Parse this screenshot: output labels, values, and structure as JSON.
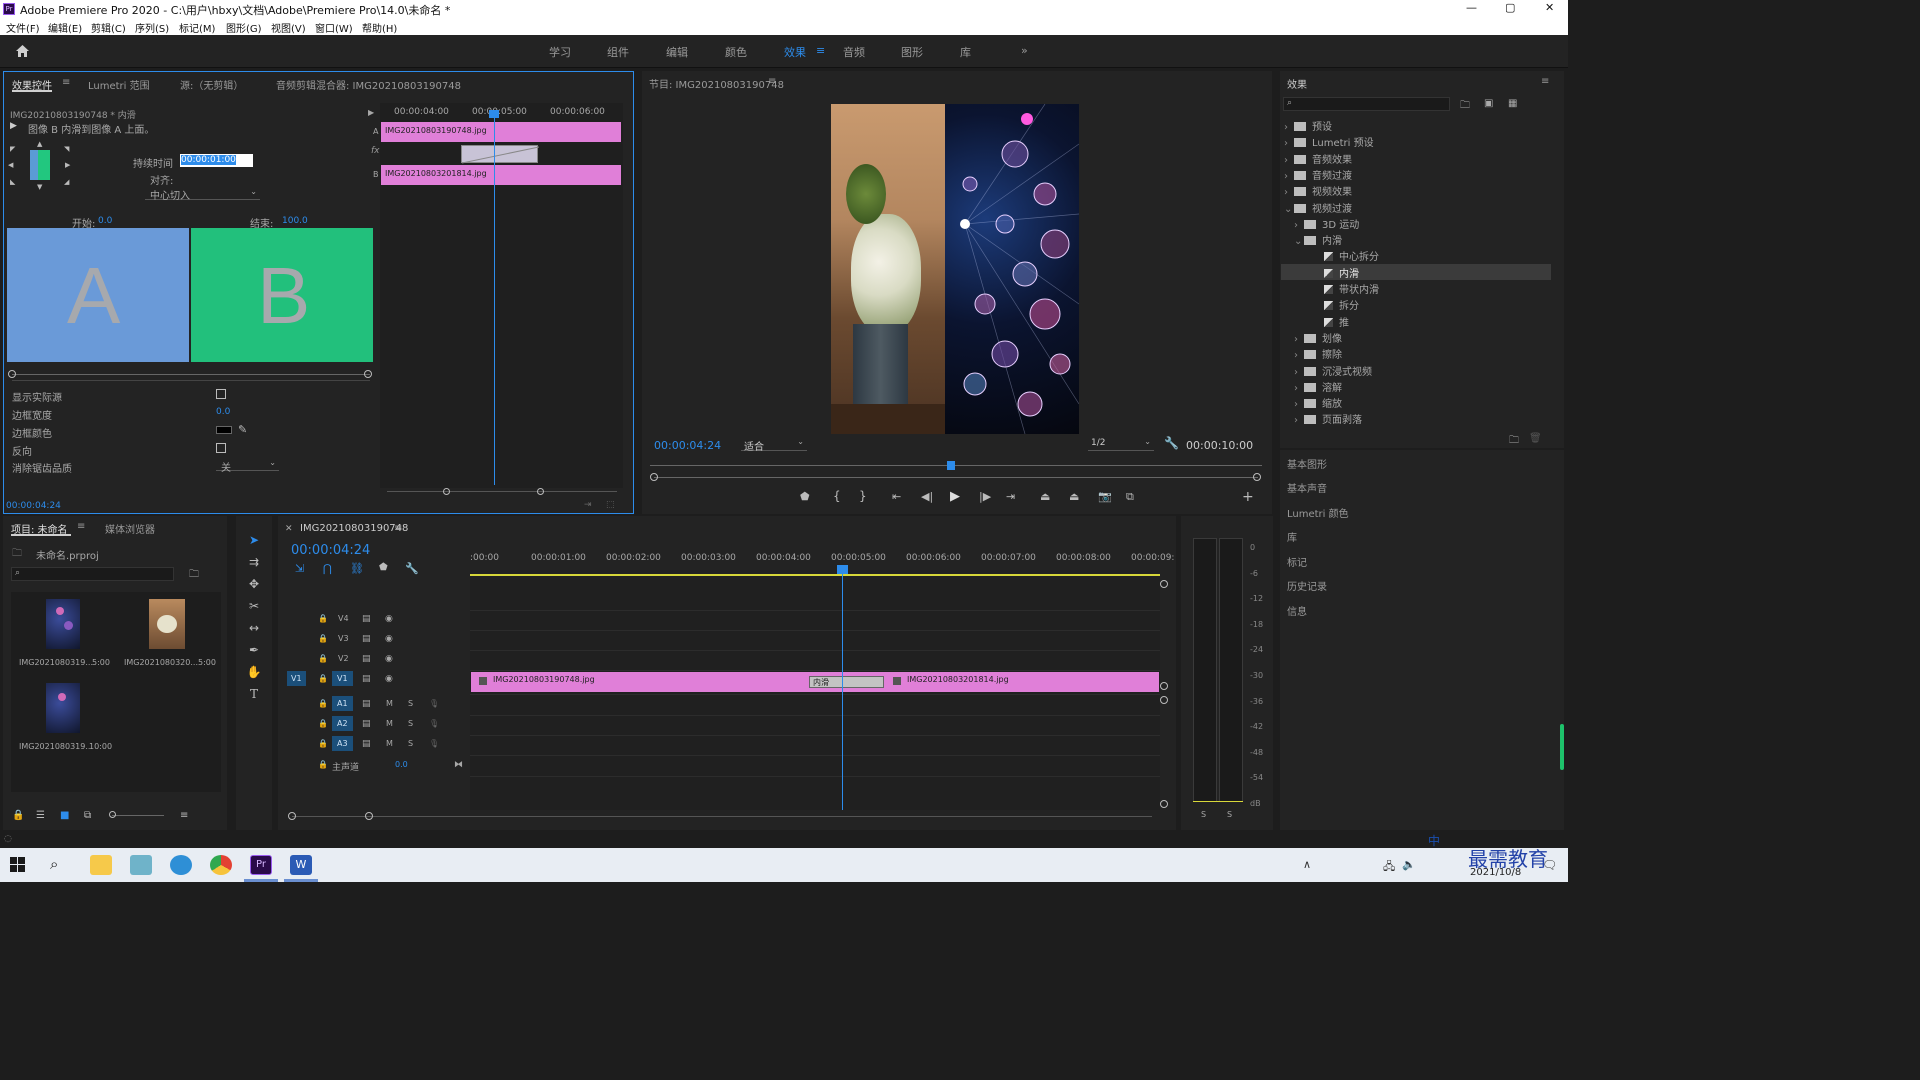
{
  "window": {
    "title": "Adobe Premiere Pro 2020 - C:\\用户\\hbxy\\文档\\Adobe\\Premiere Pro\\14.0\\未命名 *",
    "controls": {
      "minimize": "—",
      "maximize": "▢",
      "close": "✕"
    }
  },
  "menu": [
    "文件(F)",
    "编辑(E)",
    "剪辑(C)",
    "序列(S)",
    "标记(M)",
    "图形(G)",
    "视图(V)",
    "窗口(W)",
    "帮助(H)"
  ],
  "workspaces": [
    "学习",
    "组件",
    "编辑",
    "颜色",
    "效果",
    "音频",
    "图形",
    "库"
  ],
  "workspace_active": "效果",
  "workspace_more": "»",
  "effect_controls": {
    "tabs": [
      "效果控件",
      "Lumetri 范围",
      "源:（无剪辑）",
      "音频剪辑混合器: IMG20210803190748"
    ],
    "clip_header": "IMG20210803190748 * 内滑",
    "description": "图像 B 内滑到图像 A 上面。",
    "duration_label": "持续时间",
    "duration_value": "00:00:01:00",
    "align_label": "对齐:",
    "align_value": "中心切入",
    "start_label": "开始:",
    "start_value": "0.0",
    "end_label": "结束:",
    "end_value": "100.0",
    "preview_a": "A",
    "preview_b": "B",
    "props": [
      {
        "label": "显示实际源",
        "type": "checkbox"
      },
      {
        "label": "边框宽度",
        "value": "0.0"
      },
      {
        "label": "边框颜色",
        "type": "color"
      },
      {
        "label": "反向",
        "type": "checkbox"
      },
      {
        "label": "消除锯齿品质",
        "value": "关"
      }
    ],
    "timecode": "00:00:04:24",
    "mini_ruler": [
      "00:00:04:00",
      "00:00:05:00",
      "00:00:06:00"
    ],
    "track_a_letter": "A",
    "track_b_letter": "B",
    "fx_letter": "fx",
    "clip_a": "IMG20210803190748.jpg",
    "clip_b": "IMG20210803201814.jpg"
  },
  "program": {
    "title": "节目: IMG20210803190748",
    "timecode": "00:00:04:24",
    "fit": "适合",
    "resolution": "1/2",
    "duration": "00:00:10:00"
  },
  "effects_panel": {
    "title": "效果",
    "tree": [
      {
        "label": "预设",
        "level": 0,
        "kind": "folder",
        "state": "closed"
      },
      {
        "label": "Lumetri 预设",
        "level": 0,
        "kind": "folder",
        "state": "closed"
      },
      {
        "label": "音频效果",
        "level": 0,
        "kind": "folder",
        "state": "closed"
      },
      {
        "label": "音频过渡",
        "level": 0,
        "kind": "folder",
        "state": "closed"
      },
      {
        "label": "视频效果",
        "level": 0,
        "kind": "folder",
        "state": "closed"
      },
      {
        "label": "视频过渡",
        "level": 0,
        "kind": "folder",
        "state": "open"
      },
      {
        "label": "3D 运动",
        "level": 1,
        "kind": "folder",
        "state": "closed"
      },
      {
        "label": "内滑",
        "level": 1,
        "kind": "folder",
        "state": "open"
      },
      {
        "label": "中心拆分",
        "level": 2,
        "kind": "effect"
      },
      {
        "label": "内滑",
        "level": 2,
        "kind": "effect",
        "selected": true
      },
      {
        "label": "带状内滑",
        "level": 2,
        "kind": "effect"
      },
      {
        "label": "拆分",
        "level": 2,
        "kind": "effect"
      },
      {
        "label": "推",
        "level": 2,
        "kind": "effect"
      },
      {
        "label": "划像",
        "level": 1,
        "kind": "folder",
        "state": "closed"
      },
      {
        "label": "擦除",
        "level": 1,
        "kind": "folder",
        "state": "closed"
      },
      {
        "label": "沉浸式视频",
        "level": 1,
        "kind": "folder",
        "state": "closed"
      },
      {
        "label": "溶解",
        "level": 1,
        "kind": "folder",
        "state": "closed"
      },
      {
        "label": "缩放",
        "level": 1,
        "kind": "folder",
        "state": "closed"
      },
      {
        "label": "页面剥落",
        "level": 1,
        "kind": "folder",
        "state": "closed"
      }
    ],
    "collapsed_panels": [
      "基本图形",
      "基本声音",
      "Lumetri 颜色",
      "库",
      "标记",
      "历史记录",
      "信息"
    ]
  },
  "project": {
    "tabs": [
      "项目: 未命名",
      "媒体浏览器"
    ],
    "file": "未命名.prproj",
    "items": [
      {
        "name": "IMG2021080319...",
        "duration": "5:00"
      },
      {
        "name": "IMG2021080320...",
        "duration": "5:00"
      },
      {
        "name": "IMG2021080319...",
        "duration": "10:00"
      }
    ]
  },
  "timeline": {
    "tab": "IMG20210803190748",
    "timecode": "00:00:04:24",
    "ruler": [
      ":00:00",
      "00:00:01:00",
      "00:00:02:00",
      "00:00:03:00",
      "00:00:04:00",
      "00:00:05:00",
      "00:00:06:00",
      "00:00:07:00",
      "00:00:08:00",
      "00:00:09:"
    ],
    "video_tracks": [
      "V4",
      "V3",
      "V2",
      "V1"
    ],
    "audio_tracks": [
      "A1",
      "A2",
      "A3"
    ],
    "source_patch_v": "V1",
    "master_label": "主声道",
    "master_value": "0.0",
    "mute": "M",
    "solo": "S",
    "clip1": "IMG20210803190748.jpg",
    "clip2": "IMG20210803201814.jpg",
    "transition": "内滑"
  },
  "meter": {
    "scale": [
      "0",
      "-6",
      "-12",
      "-18",
      "-24",
      "-30",
      "-36",
      "-42",
      "-48",
      "-54",
      "dB"
    ],
    "solo_buttons": [
      "S",
      "S"
    ]
  },
  "taskbar": {
    "time": "2021/10/8",
    "ime": "中",
    "watermark": "最需教育"
  }
}
